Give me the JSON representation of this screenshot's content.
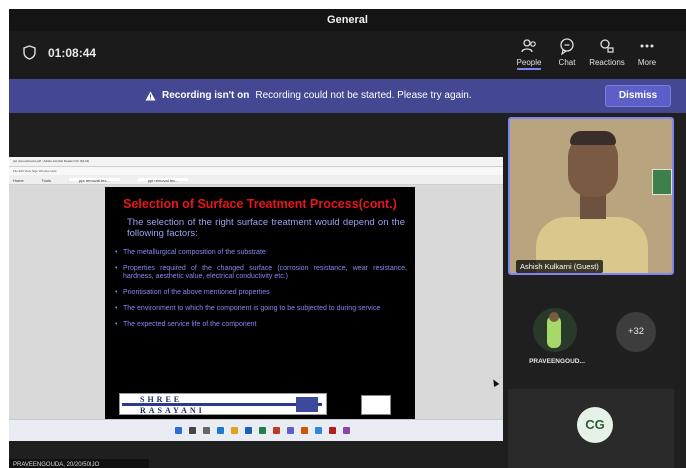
{
  "window": {
    "title": "General"
  },
  "toolbar": {
    "timer": "01:08:44",
    "people_label": "People",
    "chat_label": "Chat",
    "reactions_label": "Reactions",
    "more_label": "More"
  },
  "banner": {
    "title": "Recording isn't on",
    "message": "Recording could not be started. Please try again.",
    "dismiss_label": "Dismiss"
  },
  "shared_screen": {
    "window_title": "ppt removal texts.pdf - Adobe Acrobat Reader DC (64-bit)",
    "menu": "File  Edit  View  Sign  Window  Help",
    "tabs": [
      "Home",
      "Tools",
      "ppt removal tex...",
      "ppt removal tex..."
    ],
    "slide": {
      "title": "Selection of Surface Treatment Process(cont.)",
      "intro": "The selection of the right surface treatment would depend on the following factors:",
      "bullets": [
        "The metallurgical composition of the substrate",
        "Properties required of the changed surface (corrosion resistance, wear resistance, hardness, aesthetic value, electrical conductivity etc.)",
        "Prioritisation of the above mentioned properties",
        "The environment to which the component is going to be subjected to during service",
        "The expected service life of the component"
      ],
      "logo_line1": "SHREE",
      "logo_line2": "RASAYANI"
    }
  },
  "participants": {
    "speaker_name": "Ashish Kulkarni (Guest)",
    "avatar_name": "PRAVEENGOUD...",
    "more_count": "+32",
    "initials": "CG",
    "bottom_label": "PRAVEENGOUDA, 20/20/50IJO"
  }
}
